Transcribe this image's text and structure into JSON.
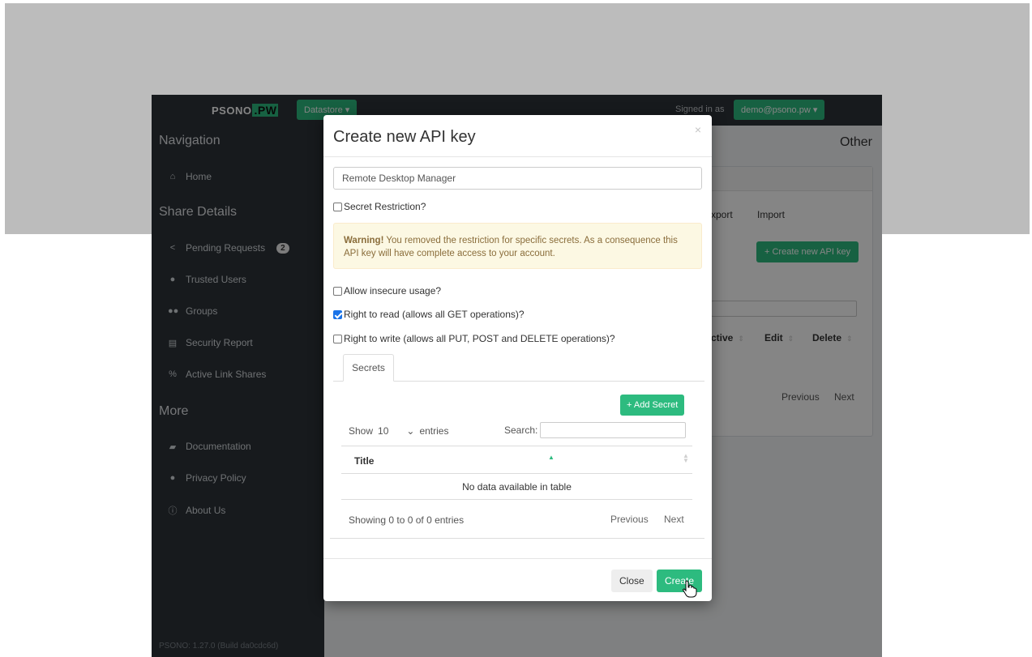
{
  "app": {
    "brand_prefix": "PSONO",
    "brand_suffix": ".PW",
    "datastore_label": "Datastore ▾",
    "signed_in_label": "Signed in as",
    "user_label": "demo@psono.pw ▾",
    "build": "PSONO: 1.27.0 (Build da0cdc6d)"
  },
  "sidebar": {
    "navigation_heading": "Navigation",
    "home": "Home",
    "share_details_heading": "Share Details",
    "pending_requests": "Pending Requests",
    "pending_count": "2",
    "trusted_users": "Trusted Users",
    "groups": "Groups",
    "security_report": "Security Report",
    "active_link_shares": "Active Link Shares",
    "more_heading": "More",
    "documentation": "Documentation",
    "privacy_policy": "Privacy Policy",
    "about_us": "About Us"
  },
  "main": {
    "other_label": "Other",
    "tab_export": "xport",
    "tab_import": "Import",
    "create_api_key": "+ Create new API key",
    "col_active": "ctive",
    "col_edit": "Edit",
    "col_delete": "Delete",
    "previous": "Previous",
    "next": "Next"
  },
  "modal": {
    "title": "Create new API key",
    "close_x": "×",
    "api_title_value": "Remote Desktop Manager",
    "secret_restriction": "Secret Restriction?",
    "secret_restriction_checked": false,
    "warning_strong": "Warning!",
    "warning_text": " You removed the restriction for specific secrets. As a consequence this API key will have complete access to your account.",
    "allow_insecure": "Allow insecure usage?",
    "allow_insecure_checked": false,
    "right_read": "Right to read (allows all GET operations)?",
    "right_read_checked": true,
    "right_write": "Right to write (allows all PUT, POST and DELETE operations)?",
    "right_write_checked": false,
    "tab_secrets": "Secrets",
    "add_secret": "+ Add Secret",
    "show_label": "Show",
    "entries_value": "10",
    "entries_label": "entries",
    "search_label": "Search:",
    "col_title": "Title",
    "empty_text": "No data available in table",
    "info_text": "Showing 0 to 0 of 0 entries",
    "previous": "Previous",
    "next": "Next",
    "close_button": "Close",
    "create_button": "Create"
  },
  "colors": {
    "accent": "#2dbb7f",
    "sidebar": "#2d3339",
    "warning_bg": "#fcf8e3",
    "warning_text": "#8a6d3b"
  }
}
